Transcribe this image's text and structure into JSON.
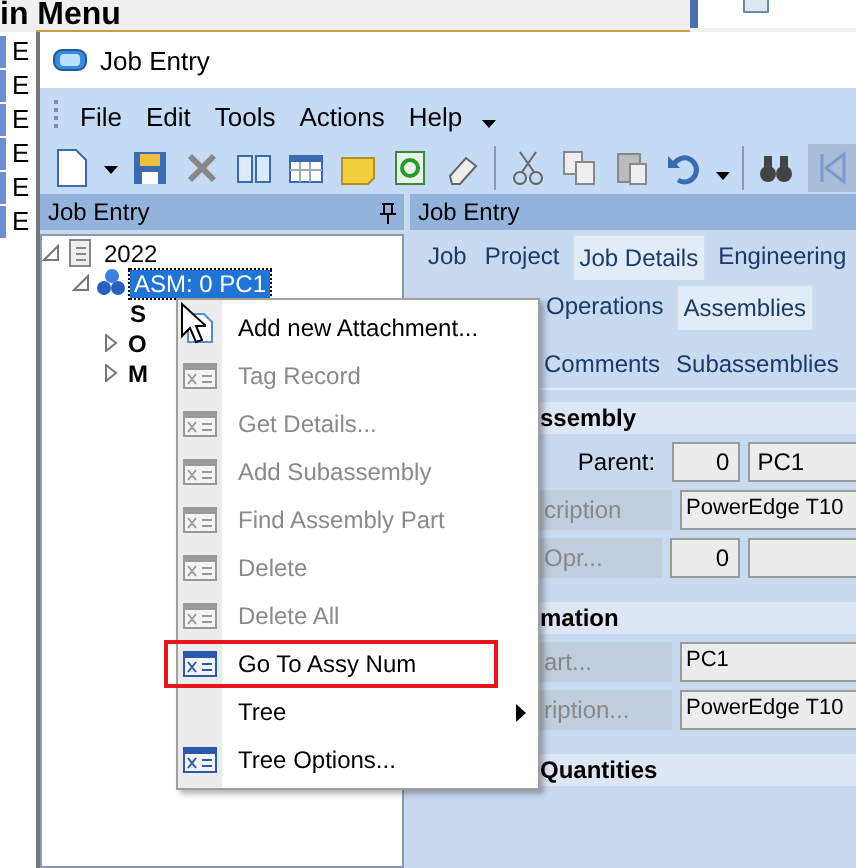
{
  "main_menu": {
    "title": "in Menu",
    "side_items": [
      "E",
      "E",
      "E",
      "E",
      "E",
      "E"
    ]
  },
  "window": {
    "title": "Job Entry"
  },
  "menu_bar": [
    "File",
    "Edit",
    "Tools",
    "Actions",
    "Help"
  ],
  "left_pane": {
    "title": "Job Entry",
    "tree": [
      {
        "label": "2022",
        "kind": "document",
        "expanded": true,
        "selected": false,
        "children": [
          {
            "label": "ASM: 0 PC1",
            "kind": "assembly",
            "expanded": true,
            "selected": true,
            "children": [
              {
                "label": "S",
                "kind": "group",
                "selected": false
              },
              {
                "label": "O",
                "kind": "group",
                "expanded": false,
                "selected": false
              },
              {
                "label": "M",
                "kind": "group",
                "expanded": false,
                "selected": false
              }
            ]
          }
        ]
      }
    ]
  },
  "right_pane": {
    "title": "Job Entry",
    "tab_rows": [
      [
        {
          "label": "Job",
          "selected": false
        },
        {
          "label": "Project",
          "selected": false
        },
        {
          "label": "Job Details",
          "selected": true
        },
        {
          "label": "Engineering",
          "selected": false
        }
      ],
      [
        {
          "label": "Operations",
          "selected": false
        },
        {
          "label": "Assemblies",
          "selected": true
        }
      ],
      [
        {
          "label": "Comments",
          "selected": false
        },
        {
          "label": "Subassemblies",
          "selected": false
        }
      ]
    ],
    "sections": [
      {
        "title": "ssembly",
        "rows": [
          {
            "label": "Parent:",
            "kind": "plain",
            "fields": [
              {
                "kind": "number",
                "value": "0"
              },
              {
                "kind": "text",
                "value": "PC1"
              }
            ]
          },
          {
            "label": "cription",
            "kind": "button",
            "fields": [
              {
                "kind": "wide",
                "value": "PowerEdge T10"
              }
            ]
          },
          {
            "label": "Opr...",
            "kind": "button",
            "fields": [
              {
                "kind": "number",
                "value": "0"
              },
              {
                "kind": "text"
              }
            ]
          }
        ]
      },
      {
        "title": "mation",
        "rows": [
          {
            "label": "art...",
            "kind": "button",
            "fields": [
              {
                "kind": "wide",
                "value": "PC1"
              }
            ]
          },
          {
            "label": "ription...",
            "kind": "button",
            "fields": [
              {
                "kind": "wide",
                "value": "PowerEdge T10"
              }
            ]
          }
        ]
      },
      {
        "title": "Quantities"
      }
    ]
  },
  "context_menu": {
    "items": [
      {
        "label": "Add new Attachment...",
        "kind": "attach",
        "disabled": false,
        "highlighted": false
      },
      {
        "label": "Tag Record",
        "kind": "command",
        "disabled": true,
        "highlighted": false
      },
      {
        "label": "Get Details...",
        "kind": "command",
        "disabled": true,
        "highlighted": false
      },
      {
        "label": "Add Subassembly",
        "kind": "command",
        "disabled": true,
        "highlighted": false
      },
      {
        "label": "Find Assembly Part",
        "kind": "command",
        "disabled": true,
        "highlighted": false
      },
      {
        "label": "Delete",
        "kind": "command",
        "disabled": true,
        "highlighted": false
      },
      {
        "label": "Delete All",
        "kind": "command",
        "disabled": true,
        "highlighted": false
      },
      {
        "label": "Go To Assy Num",
        "kind": "command",
        "disabled": false,
        "highlighted": true
      },
      {
        "label": "Tree",
        "kind": "submenu",
        "disabled": false,
        "highlighted": false
      },
      {
        "label": "Tree Options...",
        "kind": "command",
        "disabled": false,
        "highlighted": false
      }
    ]
  }
}
